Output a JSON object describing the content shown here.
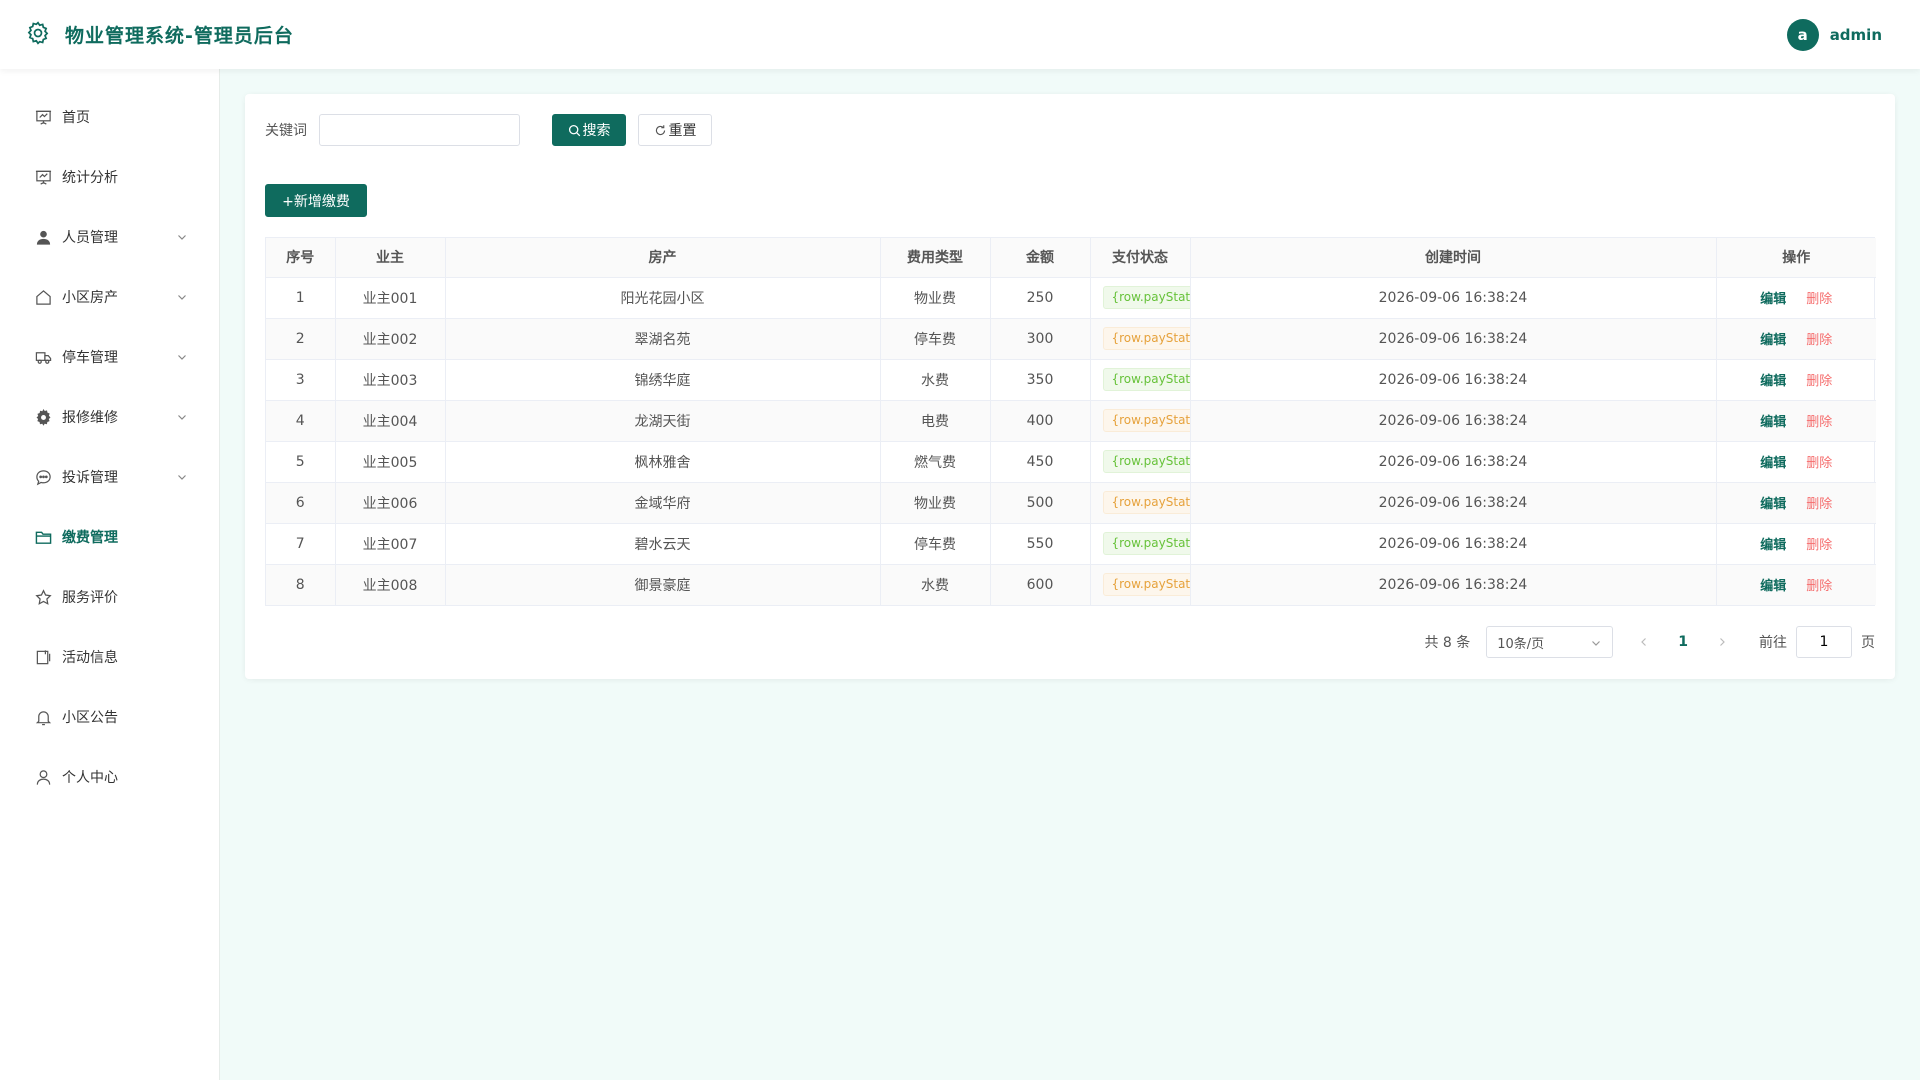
{
  "header": {
    "title": "物业管理系统-管理员后台",
    "avatar_letter": "a",
    "user_name": "admin",
    "brand_color": "#0f6b5e"
  },
  "sidebar": {
    "items": [
      {
        "label": "首页",
        "icon": "presentation-chart-icon",
        "active": false,
        "expandable": false
      },
      {
        "label": "统计分析",
        "icon": "presentation-chart-icon",
        "active": false,
        "expandable": false
      },
      {
        "label": "人员管理",
        "icon": "user-icon",
        "active": false,
        "expandable": true
      },
      {
        "label": "小区房产",
        "icon": "house-icon",
        "active": false,
        "expandable": true
      },
      {
        "label": "停车管理",
        "icon": "truck-icon",
        "active": false,
        "expandable": true
      },
      {
        "label": "报修维修",
        "icon": "gear-icon",
        "active": false,
        "expandable": true
      },
      {
        "label": "投诉管理",
        "icon": "chat-bubble-icon",
        "active": false,
        "expandable": true
      },
      {
        "label": "缴费管理",
        "icon": "folder-icon",
        "active": true,
        "expandable": false
      },
      {
        "label": "服务评价",
        "icon": "star-icon",
        "active": false,
        "expandable": false
      },
      {
        "label": "活动信息",
        "icon": "notebook-icon",
        "active": false,
        "expandable": false
      },
      {
        "label": "小区公告",
        "icon": "bell-icon",
        "active": false,
        "expandable": false
      },
      {
        "label": "个人中心",
        "icon": "user-outline-icon",
        "active": false,
        "expandable": false
      }
    ]
  },
  "search": {
    "label": "关键词",
    "value": "",
    "placeholder": "",
    "search_label": "搜索",
    "reset_label": "重置"
  },
  "toolbar": {
    "add_label": "+新增缴费"
  },
  "table": {
    "columns": [
      "序号",
      "业主",
      "房产",
      "费用类型",
      "金额",
      "支付状态",
      "创建时间",
      "操作"
    ],
    "edit_label": "编辑",
    "delete_label": "删除",
    "rows": [
      {
        "index": "1",
        "owner": "业主001",
        "property": "阳光花园小区",
        "fee_type": "物业费",
        "amount": "250",
        "status": "{row.payStatus",
        "status_color": "green",
        "created": "2026-09-06 16:38:24"
      },
      {
        "index": "2",
        "owner": "业主002",
        "property": "翠湖名苑",
        "fee_type": "停车费",
        "amount": "300",
        "status": "{row.payStatus",
        "status_color": "orange",
        "created": "2026-09-06 16:38:24"
      },
      {
        "index": "3",
        "owner": "业主003",
        "property": "锦绣华庭",
        "fee_type": "水费",
        "amount": "350",
        "status": "{row.payStatus",
        "status_color": "green",
        "created": "2026-09-06 16:38:24"
      },
      {
        "index": "4",
        "owner": "业主004",
        "property": "龙湖天街",
        "fee_type": "电费",
        "amount": "400",
        "status": "{row.payStatus",
        "status_color": "orange",
        "created": "2026-09-06 16:38:24"
      },
      {
        "index": "5",
        "owner": "业主005",
        "property": "枫林雅舍",
        "fee_type": "燃气费",
        "amount": "450",
        "status": "{row.payStatus",
        "status_color": "green",
        "created": "2026-09-06 16:38:24"
      },
      {
        "index": "6",
        "owner": "业主006",
        "property": "金域华府",
        "fee_type": "物业费",
        "amount": "500",
        "status": "{row.payStatus",
        "status_color": "orange",
        "created": "2026-09-06 16:38:24"
      },
      {
        "index": "7",
        "owner": "业主007",
        "property": "碧水云天",
        "fee_type": "停车费",
        "amount": "550",
        "status": "{row.payStatus",
        "status_color": "green",
        "created": "2026-09-06 16:38:24"
      },
      {
        "index": "8",
        "owner": "业主008",
        "property": "御景豪庭",
        "fee_type": "水费",
        "amount": "600",
        "status": "{row.payStatus",
        "status_color": "orange",
        "created": "2026-09-06 16:38:24"
      }
    ]
  },
  "pagination": {
    "total_text": "共 8 条",
    "page_size": "10条/页",
    "current_page": "1",
    "goto_label": "前往",
    "goto_value": "1",
    "page_suffix": "页"
  }
}
